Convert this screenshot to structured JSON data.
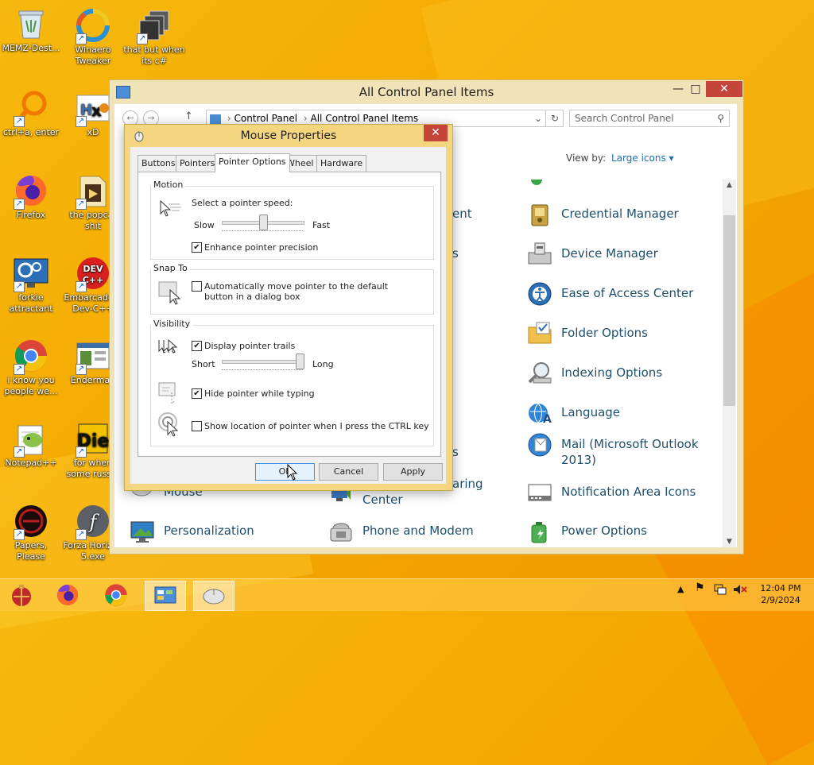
{
  "desktop": {
    "icons": [
      {
        "label": "MEMZ-Dest..."
      },
      {
        "label": "Winaero Tweaker"
      },
      {
        "label": "that but when its c#"
      },
      {
        "label": "ctrl+a, enter"
      },
      {
        "label": "xD"
      },
      {
        "label": "Firefox"
      },
      {
        "label": "the popcat shit"
      },
      {
        "label": "forkie attractant"
      },
      {
        "label": "Embarcadero Dev-C++"
      },
      {
        "label": "i know you people we..."
      },
      {
        "label": "Enderman"
      },
      {
        "label": "Notepad++"
      },
      {
        "label": "for when some russ..."
      },
      {
        "label": "Papers, Please"
      },
      {
        "label": "Forza Horizon 5.exe"
      }
    ]
  },
  "control_panel": {
    "title": "All Control Panel Items",
    "breadcrumb": [
      "Control Panel",
      "All Control Panel Items"
    ],
    "search_placeholder": "Search Control Panel",
    "view_by_label": "View by:",
    "view_by_value": "Large icons",
    "items": [
      {
        "label": "ent"
      },
      {
        "label": "s"
      },
      {
        "label": "s"
      },
      {
        "label": "aring"
      },
      {
        "label": "Center"
      },
      {
        "label": "Mouse"
      },
      {
        "label": "Personalization"
      },
      {
        "label": "Phone and Modem"
      },
      {
        "label": "Credential Manager"
      },
      {
        "label": "Device Manager"
      },
      {
        "label": "Ease of Access Center"
      },
      {
        "label": "Folder Options"
      },
      {
        "label": "Indexing Options"
      },
      {
        "label": "Language"
      },
      {
        "label": "Mail (Microsoft Outlook 2013)"
      },
      {
        "label": "Notification Area Icons"
      },
      {
        "label": "Power Options"
      }
    ]
  },
  "mouse_properties": {
    "title": "Mouse Properties",
    "tabs": [
      "Buttons",
      "Pointers",
      "Pointer Options",
      "Wheel",
      "Hardware"
    ],
    "selected_tab": "Pointer Options",
    "motion": {
      "legend": "Motion",
      "speed_label": "Select a pointer speed:",
      "slow": "Slow",
      "fast": "Fast",
      "speed_value": 0.5,
      "enhance_label": "Enhance pointer precision",
      "enhance_checked": true
    },
    "snap": {
      "legend": "Snap To",
      "label": "Automatically move pointer to the default button in a dialog box",
      "checked": false
    },
    "visibility": {
      "legend": "Visibility",
      "trails_label": "Display pointer trails",
      "trails_checked": true,
      "short": "Short",
      "long": "Long",
      "trails_value": 1.0,
      "hide_label": "Hide pointer while typing",
      "hide_checked": true,
      "ctrl_label": "Show location of pointer when I press the CTRL key",
      "ctrl_checked": false
    },
    "buttons": {
      "ok": "OK",
      "cancel": "Cancel",
      "apply": "Apply"
    }
  },
  "taskbar": {
    "time": "12:04 PM",
    "date": "2/9/2024"
  },
  "colors": {
    "wallpaper": "#f4a900",
    "window_frame": "#f3d67f",
    "close_button": "#c6453a",
    "link_text": "#1e4f6c",
    "accent_blue": "#1a5fd0"
  }
}
